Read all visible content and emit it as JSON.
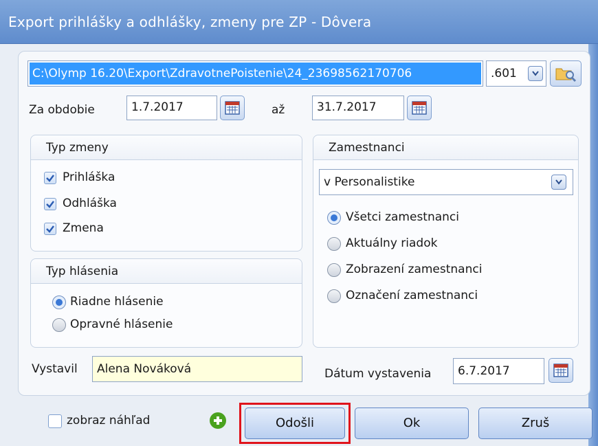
{
  "window": {
    "title": "Export prihlášky a odhlášky, zmeny pre ZP - Dôvera"
  },
  "export": {
    "path_value": "C:\\Olymp 16.20\\Export\\ZdravotnePoistenie\\24_23698562170706",
    "extension_value": ".601"
  },
  "period": {
    "label_from": "Za obdobie",
    "from_value": "1.7.2017",
    "label_to": "až",
    "to_value": "31.7.2017"
  },
  "change_type": {
    "title": "Typ zmeny",
    "options": [
      {
        "label": "Prihláška",
        "checked": true
      },
      {
        "label": "Odhláška",
        "checked": true
      },
      {
        "label": "Zmena",
        "checked": true
      }
    ]
  },
  "report_type": {
    "title": "Typ hlásenia",
    "options": [
      {
        "label": "Riadne hlásenie",
        "selected": true
      },
      {
        "label": "Opravné hlásenie",
        "selected": false
      }
    ]
  },
  "employees": {
    "title": "Zamestnanci",
    "source_value": "v Personalistike",
    "options": [
      {
        "label": "Všetci zamestnanci",
        "selected": true
      },
      {
        "label": "Aktuálny riadok",
        "selected": false
      },
      {
        "label": "Zobrazení zamestnanci",
        "selected": false
      },
      {
        "label": "Označení zamestnanci",
        "selected": false
      }
    ]
  },
  "issuer": {
    "label": "Vystavil",
    "value": "Alena Nováková"
  },
  "issue_date": {
    "label": "Dátum vystavenia",
    "value": "6.7.2017"
  },
  "footer": {
    "preview_label": "zobraz náhľad",
    "preview_checked": false,
    "send_label": "Odošli",
    "ok_label": "Ok",
    "cancel_label": "Zruš"
  },
  "colors": {
    "title_bar": "#6f97d3",
    "selection": "#3399ff",
    "highlight_box": "#e0141c",
    "issuer_field_bg": "#ffffdd"
  }
}
